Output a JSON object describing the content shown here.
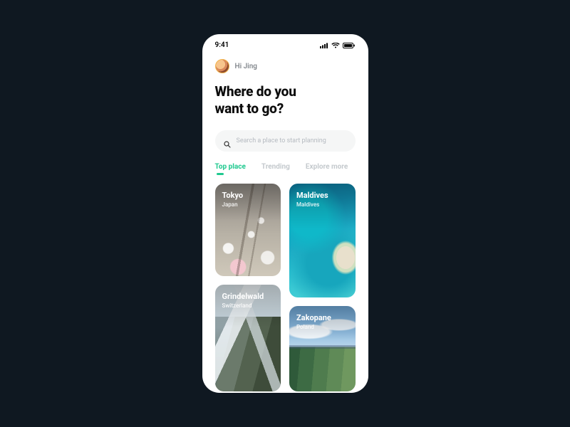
{
  "statusbar": {
    "time": "9:41"
  },
  "user": {
    "greeting": "Hi Jing"
  },
  "headline": "Where do you\nwant to go?",
  "search": {
    "placeholder": "Search a place to start planning"
  },
  "tabs": [
    {
      "label": "Top place",
      "active": true
    },
    {
      "label": "Trending",
      "active": false
    },
    {
      "label": "Explore more",
      "active": false
    }
  ],
  "cards": [
    {
      "title": "Tokyo",
      "sub": "Japan"
    },
    {
      "title": "Maldives",
      "sub": "Maldives"
    },
    {
      "title": "Grindelwald",
      "sub": "Switzerland"
    },
    {
      "title": "Zakopane",
      "sub": "Poland"
    }
  ],
  "colors": {
    "accent": "#1fc98f",
    "page_bg": "#0f1821"
  }
}
